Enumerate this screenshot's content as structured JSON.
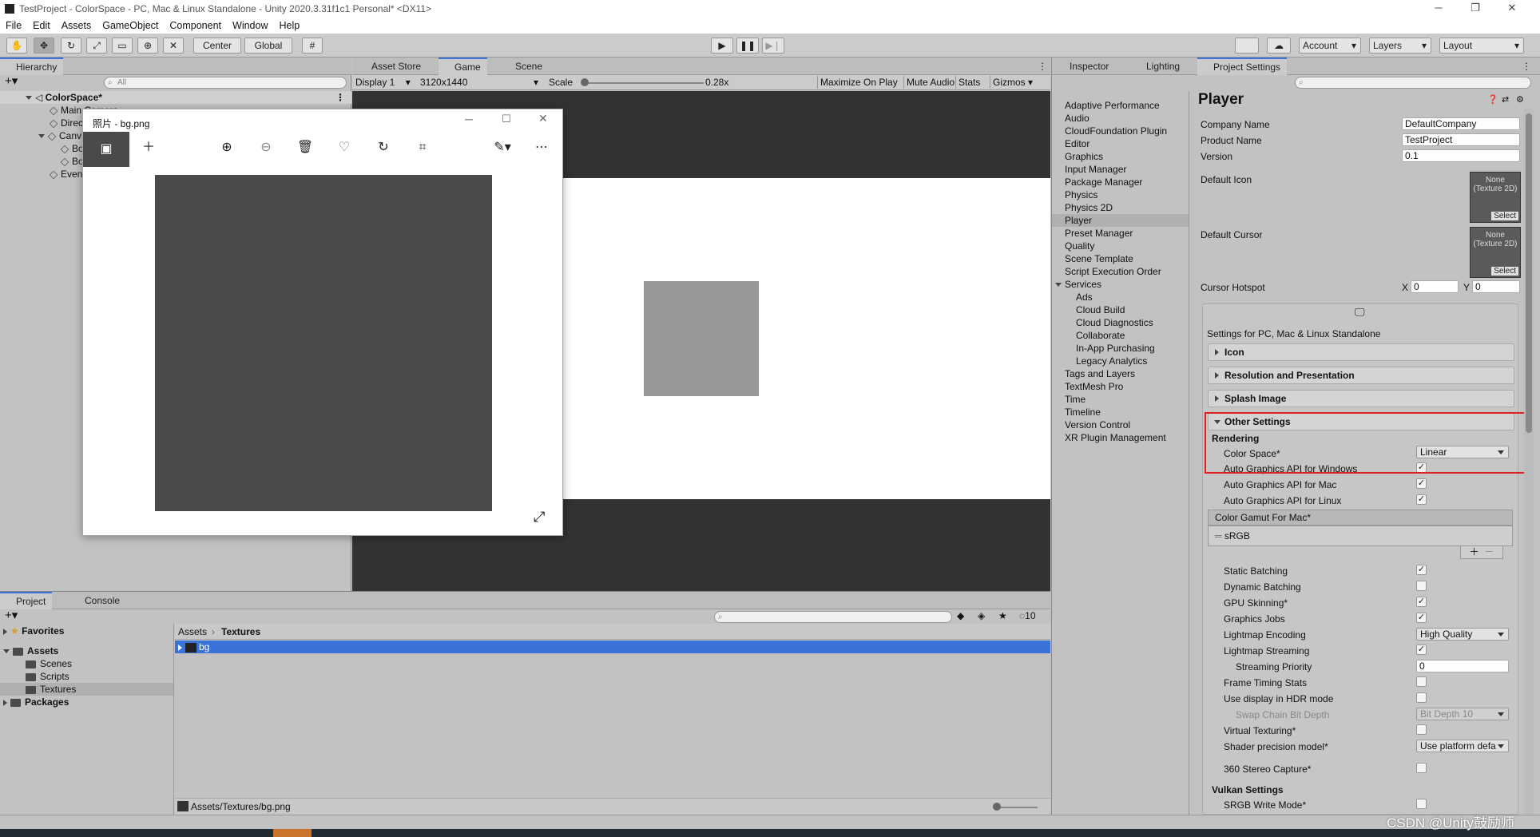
{
  "window": {
    "title": "TestProject - ColorSpace - PC, Mac & Linux Standalone - Unity 2020.3.31f1c1 Personal* <DX11>"
  },
  "menu": [
    "File",
    "Edit",
    "Assets",
    "GameObject",
    "Component",
    "Window",
    "Help"
  ],
  "toolbar": {
    "center": "Center",
    "global": "Global",
    "account": "Account",
    "layers": "Layers",
    "layout": "Layout"
  },
  "hierarchy": {
    "tab": "Hierarchy",
    "search_placeholder": "All",
    "scene": "ColorSpace*",
    "items": [
      "Main Camera",
      "Direc",
      "Canv",
      "Bo",
      "Bo",
      "Even"
    ]
  },
  "game": {
    "tabs": [
      "Asset Store",
      "Game",
      "Scene"
    ],
    "display": "Display 1",
    "resolution": "3120x1440",
    "scale_label": "Scale",
    "scale_value": "0.28x",
    "maximize": "Maximize On Play",
    "mute": "Mute Audio",
    "stats": "Stats",
    "gizmos": "Gizmos"
  },
  "photo_viewer": {
    "title": "照片 - bg.png"
  },
  "project": {
    "tabs": [
      "Project",
      "Console"
    ],
    "favorites": "Favorites",
    "assets": "Assets",
    "folders": [
      "Scenes",
      "Scripts",
      "Textures"
    ],
    "packages": "Packages",
    "breadcrumb": [
      "Assets",
      "Textures"
    ],
    "selected_asset": "bg",
    "status_path": "Assets/Textures/bg.png",
    "hidden_count": "10"
  },
  "inspector": {
    "tabs": [
      "Inspector",
      "Lighting",
      "Project Settings"
    ],
    "categories": [
      "Adaptive Performance",
      "Audio",
      "CloudFoundation Plugin",
      "Editor",
      "Graphics",
      "Input Manager",
      "Package Manager",
      "Physics",
      "Physics 2D",
      "Player",
      "Preset Manager",
      "Quality",
      "Scene Template",
      "Script Execution Order",
      "Services"
    ],
    "services_children": [
      "Ads",
      "Cloud Build",
      "Cloud Diagnostics",
      "Collaborate",
      "In-App Purchasing",
      "Legacy Analytics"
    ],
    "categories_after": [
      "Tags and Layers",
      "TextMesh Pro",
      "Time",
      "Timeline",
      "Version Control",
      "XR Plugin Management"
    ],
    "selected_category": "Player",
    "player": {
      "heading": "Player",
      "company_label": "Company Name",
      "company_value": "DefaultCompany",
      "product_label": "Product Name",
      "product_value": "TestProject",
      "version_label": "Version",
      "version_value": "0.1",
      "default_icon": "Default Icon",
      "default_cursor": "Default Cursor",
      "tex_none": "None",
      "tex_type": "(Texture 2D)",
      "tex_select": "Select",
      "hotspot_label": "Cursor Hotspot",
      "hotspot_x_label": "X",
      "hotspot_x": "0",
      "hotspot_y_label": "Y",
      "hotspot_y": "0",
      "platform_settings": "Settings for PC, Mac & Linux Standalone",
      "foldouts": [
        "Icon",
        "Resolution and Presentation",
        "Splash Image",
        "Other Settings"
      ],
      "rendering": "Rendering",
      "color_space_label": "Color Space*",
      "color_space_value": "Linear",
      "auto_win": "Auto Graphics API  for Windows",
      "auto_mac": "Auto Graphics API  for Mac",
      "auto_linux": "Auto Graphics API  for Linux",
      "gamut_header": "Color Gamut For Mac*",
      "gamut_item": "sRGB",
      "static_batching": "Static Batching",
      "dynamic_batching": "Dynamic Batching",
      "gpu_skinning": "GPU Skinning*",
      "graphics_jobs": "Graphics Jobs",
      "lightmap_encoding": "Lightmap Encoding",
      "lightmap_encoding_value": "High Quality",
      "lightmap_streaming": "Lightmap Streaming",
      "streaming_priority": "Streaming Priority",
      "streaming_priority_value": "0",
      "frame_timing": "Frame Timing Stats",
      "hdr_display": "Use display in HDR mode",
      "swap_chain": "Swap Chain Bit Depth",
      "swap_chain_value": "Bit Depth 10",
      "virtual_texturing": "Virtual Texturing*",
      "shader_precision": "Shader precision model*",
      "shader_precision_value": "Use platform defa",
      "stereo360": "360 Stereo Capture*",
      "vulkan": "Vulkan Settings",
      "srgb_write": "SRGB Write Mode*"
    }
  },
  "watermark": "CSDN @Unity鼓励师",
  "colors": {
    "highlight_red": "#e02020",
    "selection_blue": "#3a72d8",
    "image_gray": "#4a4a4a",
    "game_square": "#979797"
  }
}
